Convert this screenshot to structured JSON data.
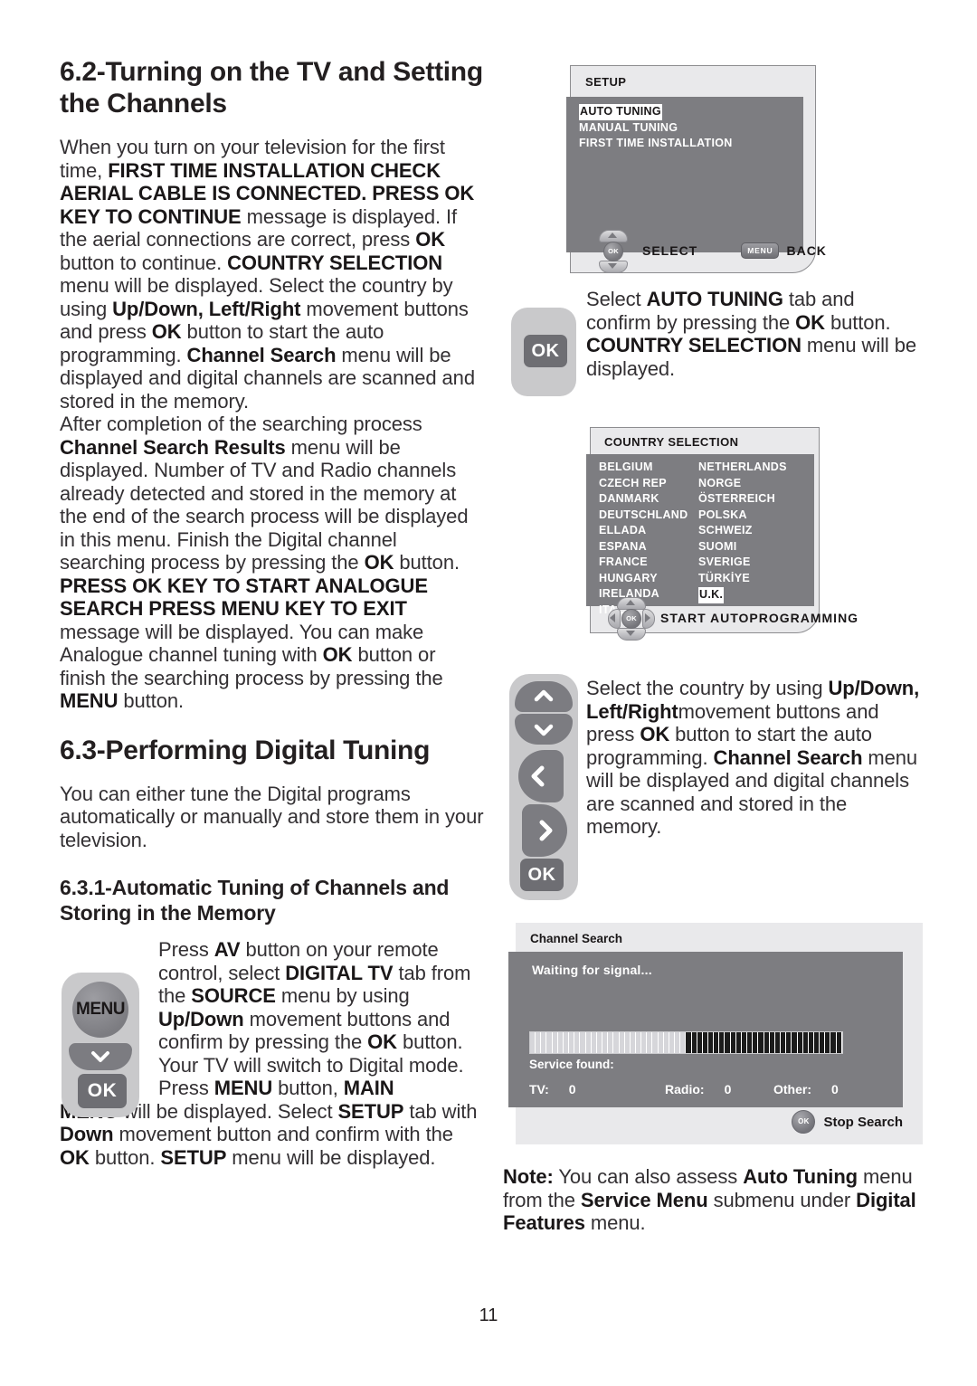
{
  "page_number": "11",
  "left_column": {
    "section_62_title": "6.2-Turning on the TV and Setting the Channels",
    "para_1": {
      "runs": [
        {
          "t": "When you turn on your television for the first time, ",
          "b": false
        },
        {
          "t": "FIRST TIME INSTALLATION CHECK AERIAL CABLE IS CONNECTED. PRESS OK KEY TO CONTINUE",
          "b": true
        },
        {
          "t": " message is displayed. If the aerial connections are correct, press ",
          "b": false
        },
        {
          "t": "OK",
          "b": true
        },
        {
          "t": " button to continue. ",
          "b": false
        },
        {
          "t": "COUNTRY SELECTION",
          "b": true
        },
        {
          "t": " menu will be displayed. Select the country by using ",
          "b": false
        },
        {
          "t": "Up/Down, Left/Right",
          "b": true
        },
        {
          "t": " movement buttons and press ",
          "b": false
        },
        {
          "t": "OK",
          "b": true
        },
        {
          "t": " button to start the auto programming. ",
          "b": false
        },
        {
          "t": "Channel Search",
          "b": true
        },
        {
          "t": " menu will be displayed and digital channels are scanned and stored in the memory.",
          "b": false
        }
      ]
    },
    "para_2": {
      "runs": [
        {
          "t": "After completion of the searching process ",
          "b": false
        },
        {
          "t": "Channel Search Results",
          "b": true
        },
        {
          "t": " menu will be displayed. Number of TV and Radio channels already detected and stored in the memory at the end of the search process will be displayed in this menu. Finish the Digital channel searching process by pressing the ",
          "b": false
        },
        {
          "t": "OK",
          "b": true
        },
        {
          "t": " button.",
          "b": false
        }
      ]
    },
    "para_3": {
      "runs": [
        {
          "t": "PRESS OK KEY TO START ANALOGUE SEARCH PRESS MENU KEY TO EXIT",
          "b": true
        },
        {
          "t": " message will be displayed. You can make Analogue channel tuning with ",
          "b": false
        },
        {
          "t": "OK",
          "b": true
        },
        {
          "t": " button or finish the searching process by pressing the ",
          "b": false
        },
        {
          "t": "MENU",
          "b": true
        },
        {
          "t": " button.",
          "b": false
        }
      ]
    },
    "section_63_title": "6.3-Performing Digital Tuning",
    "para_4": {
      "runs": [
        {
          "t": "You can either tune the Digital programs automatically or manually and store them in your television.",
          "b": false
        }
      ]
    },
    "section_631_title": "6.3.1-Automatic Tuning of Channels and Storing in the Memory",
    "para_5_indented": {
      "runs": [
        {
          "t": "Press ",
          "b": false
        },
        {
          "t": "AV",
          "b": true
        },
        {
          "t": " button on your remote control, select ",
          "b": false
        },
        {
          "t": "DIGITAL TV",
          "b": true
        },
        {
          "t": " tab from the ",
          "b": false
        },
        {
          "t": "SOURCE",
          "b": true
        },
        {
          "t": " menu by using ",
          "b": false
        },
        {
          "t": "Up/Down",
          "b": true
        },
        {
          "t": " movement buttons and confirm by pressing the ",
          "b": false
        },
        {
          "t": "OK",
          "b": true
        },
        {
          "t": " button. Your TV will switch to Digital mode. Press ",
          "b": false
        },
        {
          "t": "MENU",
          "b": true
        },
        {
          "t": " button, ",
          "b": false
        },
        {
          "t": "MAIN",
          "b": true
        }
      ]
    },
    "para_5_rest": {
      "runs": [
        {
          "t": "MENU",
          "b": true
        },
        {
          "t": " will be displayed. Select ",
          "b": false
        },
        {
          "t": "SETUP",
          "b": true
        },
        {
          "t": " tab with ",
          "b": false
        },
        {
          "t": "Down",
          "b": true
        },
        {
          "t": " movement button and confirm with the ",
          "b": false
        },
        {
          "t": "OK",
          "b": true
        },
        {
          "t": " button. ",
          "b": false
        },
        {
          "t": "SETUP",
          "b": true
        },
        {
          "t": " menu will be displayed.",
          "b": false
        }
      ]
    }
  },
  "right_column": {
    "para_auto_tuning": {
      "runs": [
        {
          "t": "Select ",
          "b": false
        },
        {
          "t": "AUTO TUNING",
          "b": true
        },
        {
          "t": " tab and confirm by pressing the ",
          "b": false
        },
        {
          "t": "OK",
          "b": true
        },
        {
          "t": " button. ",
          "b": false
        },
        {
          "t": "COUNTRY SELECTION",
          "b": true
        },
        {
          "t": " menu will be displayed.",
          "b": false
        }
      ]
    },
    "para_country": {
      "runs": [
        {
          "t": "Select the country by using ",
          "b": false
        },
        {
          "t": "Up/Down, Left/Right",
          "b": true
        },
        {
          "t": "movement buttons and press ",
          "b": false
        },
        {
          "t": "OK",
          "b": true
        },
        {
          "t": " button to start the auto programming. ",
          "b": false
        },
        {
          "t": "Channel Search",
          "b": true
        },
        {
          "t": " menu will be displayed and digital channels are scanned and stored in the memory.",
          "b": false
        }
      ]
    },
    "note": {
      "runs": [
        {
          "t": "Note:",
          "b": true
        },
        {
          "t": " You can also assess ",
          "b": false
        },
        {
          "t": "Auto Tuning",
          "b": true
        },
        {
          "t": " menu from the ",
          "b": false
        },
        {
          "t": "Service Menu",
          "b": true
        },
        {
          "t": " submenu under ",
          "b": false
        },
        {
          "t": "Digital Features",
          "b": true
        },
        {
          "t": " menu.",
          "b": false
        }
      ]
    }
  },
  "setup_panel": {
    "title": "SETUP",
    "items": [
      {
        "label": "AUTO TUNING",
        "selected": true
      },
      {
        "label": "MANUAL TUNING",
        "selected": false
      },
      {
        "label": "FIRST TIME INSTALLATION",
        "selected": false
      }
    ],
    "nav_ok_label": "OK",
    "nav_select_label": "SELECT",
    "nav_menu_key": "MENU",
    "nav_back_label": "BACK"
  },
  "country_panel": {
    "title": "COUNTRY SELECTION",
    "left_items": [
      {
        "label": "BELGIUM",
        "selected": false
      },
      {
        "label": "CZECH REP",
        "selected": false
      },
      {
        "label": "DANMARK",
        "selected": false
      },
      {
        "label": "DEUTSCHLAND",
        "selected": false
      },
      {
        "label": "ELLADA",
        "selected": false
      },
      {
        "label": "ESPANA",
        "selected": false
      },
      {
        "label": "FRANCE",
        "selected": false
      },
      {
        "label": "HUNGARY",
        "selected": false
      },
      {
        "label": "IRELANDA",
        "selected": false
      },
      {
        "label": "ITALIA",
        "selected": false
      }
    ],
    "right_items": [
      {
        "label": "NETHERLANDS",
        "selected": false
      },
      {
        "label": "NORGE",
        "selected": false
      },
      {
        "label": "ÖSTERREICH",
        "selected": false
      },
      {
        "label": "POLSKA",
        "selected": false
      },
      {
        "label": "SCHWEIZ",
        "selected": false
      },
      {
        "label": "SUOMI",
        "selected": false
      },
      {
        "label": "SVERIGE",
        "selected": false
      },
      {
        "label": "TÜRKİYE",
        "selected": false
      },
      {
        "label": "U.K.",
        "selected": true
      },
      {
        "label": "..........................",
        "selected": false
      }
    ],
    "nav_ok_label": "OK",
    "nav_action_label": "START AUTOPROGRAMMING"
  },
  "channel_search_panel": {
    "title": "Channel Search",
    "status": "Waiting for signal...",
    "progress_percent": 50,
    "service_found_label": "Service found:",
    "counts": [
      {
        "label": "TV:",
        "value": "0"
      },
      {
        "label": "Radio:",
        "value": "0"
      },
      {
        "label": "Other:",
        "value": "0"
      }
    ],
    "stop_ok_label": "OK",
    "stop_label": "Stop Search"
  },
  "remotes": {
    "menu_key_label": "MENU",
    "ok_key_label": "OK"
  },
  "colors": {
    "panel_bg": "#e9e9eb",
    "screen_bg": "#7d7d81",
    "remote_bg": "#c9c9cb",
    "key_dark": "#6e6e73",
    "text": "#231f20"
  }
}
